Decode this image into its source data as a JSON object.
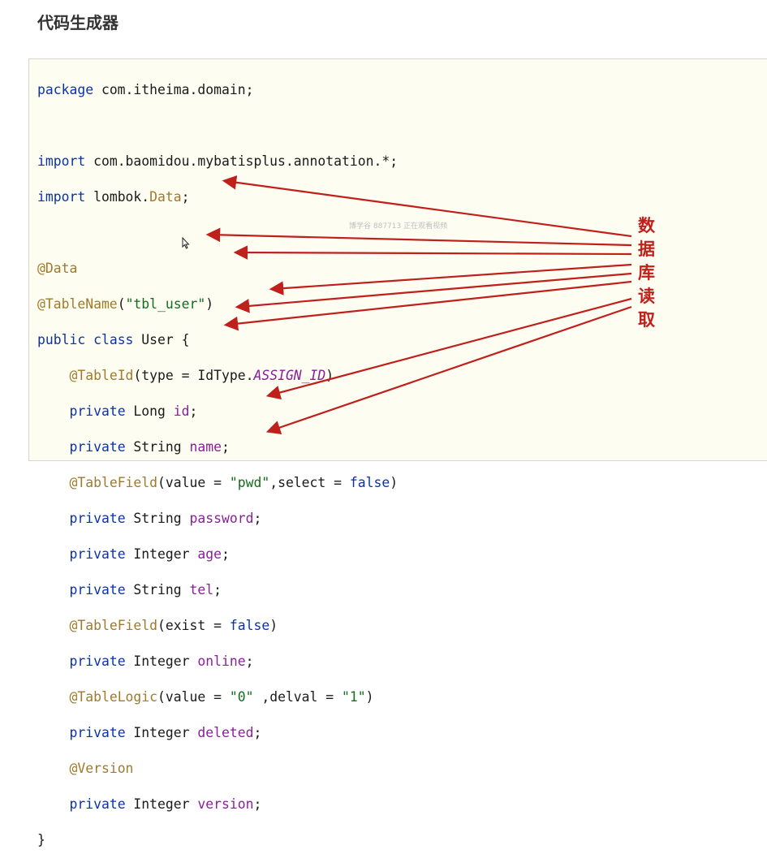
{
  "page": {
    "title": "代码生成器"
  },
  "code": {
    "package_kw": "package",
    "package_name": " com.itheima.domain;",
    "import_kw": "import",
    "import1": " com.baomidou.mybatisplus.annotation.*;",
    "import2_pre": " lombok.",
    "import2_cls": "Data",
    "import2_post": ";",
    "ann_data": "@Data",
    "ann_tablename": "@TableName",
    "tablename_open": "(",
    "tablename_val": "\"tbl_user\"",
    "tablename_close": ")",
    "public_kw": "public",
    "class_kw": " class",
    "class_name": " User {",
    "indent": "    ",
    "ann_tableid": "@TableId",
    "tableid_args_pre": "(type = IdType.",
    "tableid_const": "ASSIGN_ID",
    "tableid_args_post": ")",
    "private_kw": "private",
    "type_long": " Long ",
    "type_string": " String ",
    "type_integer": " Integer ",
    "field_id": "id",
    "field_name": "name",
    "field_password": "password",
    "field_age": "age",
    "field_tel": "tel",
    "field_online": "online",
    "field_deleted": "deleted",
    "field_version": "version",
    "semicolon": ";",
    "ann_tablefield": "@TableField",
    "tf1_pre": "(value = ",
    "tf1_str": "\"pwd\"",
    "tf1_mid": ",select = ",
    "false_kw": "false",
    "close_paren": ")",
    "tf2_pre": "(exist = ",
    "ann_tablelogic": "@TableLogic",
    "tl_pre": "(value = ",
    "tl_str1": "\"0\"",
    "tl_mid": " ,delval = ",
    "tl_str2": "\"1\"",
    "ann_version": "@Version",
    "close_brace": "}"
  },
  "watermark": "博学谷 887713 正在观看视频",
  "annotation": {
    "chars": [
      "数",
      "据",
      "库",
      "读",
      "取"
    ],
    "color": "#c0201b"
  },
  "colors": {
    "keyword": "#0b33a8",
    "annotation": "#a07a2a",
    "string": "#126e1b",
    "field": "#8a1f9a",
    "arrow": "#c0201b",
    "code_bg": "#fdfdf2"
  }
}
